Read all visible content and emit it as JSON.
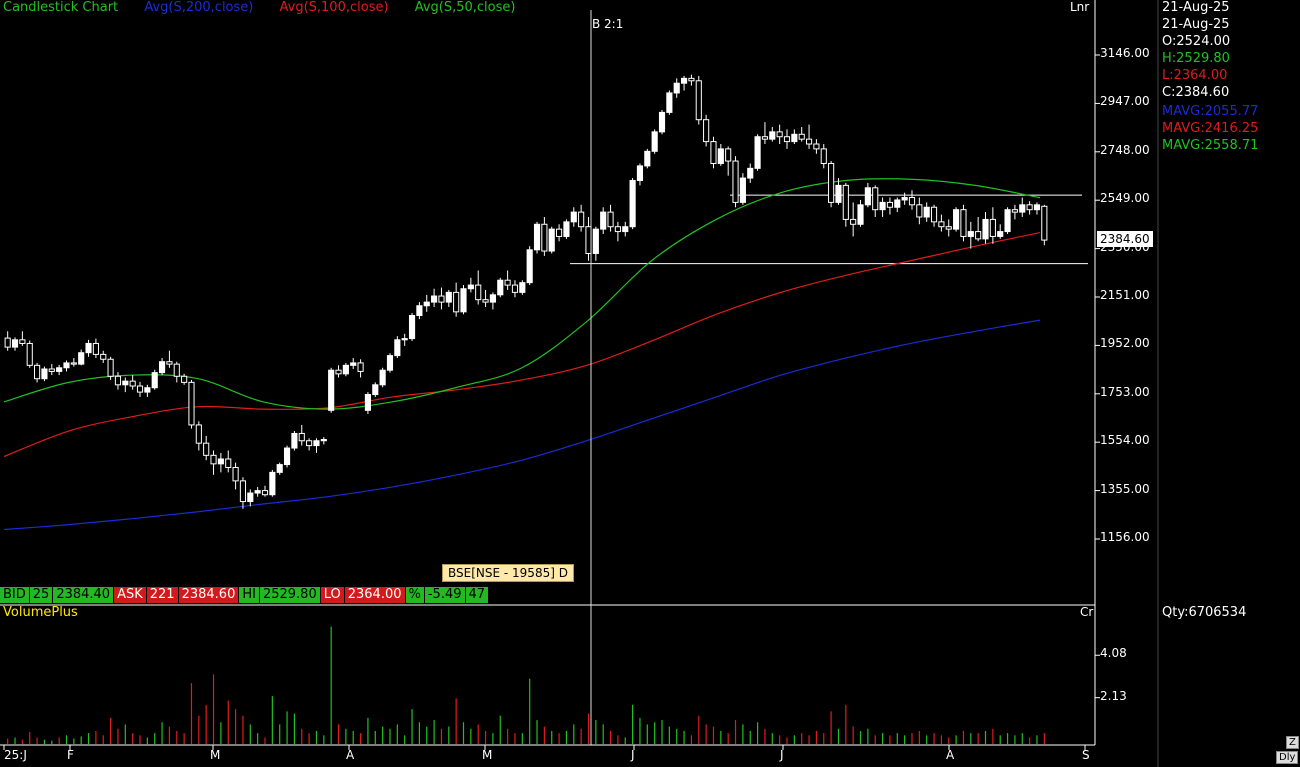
{
  "legend": {
    "title": "Candlestick Chart",
    "ma200": "Avg(S,200,close)",
    "ma100": "Avg(S,100,close)",
    "ma50": "Avg(S,50,close)"
  },
  "scale_mode": "Lnr",
  "volume_scale_unit": "Cr",
  "split_marker": "B 2:1",
  "side_panel": {
    "date1": "21-Aug-25",
    "date2": "21-Aug-25",
    "open": "O:2524.00",
    "high": "H:2529.80",
    "low": "L:2364.00",
    "close": "C:2384.60",
    "mavg200": "MAVG:2055.77",
    "mavg100": "MAVG:2416.25",
    "mavg50": "MAVG:2558.71",
    "qty": "Qty:6706534"
  },
  "quote_bar": {
    "bid_label": "BID",
    "bid_qty": "25",
    "bid_price": "2384.40",
    "ask_label": "ASK",
    "ask_qty": "221",
    "ask_price": "2384.60",
    "hi_label": "HI",
    "hi_value": "2529.80",
    "lo_label": "LO",
    "lo_value": "2364.00",
    "pct_label": "%",
    "pct_value": "-5.49",
    "extra": "47"
  },
  "tooltip": "BSE[NSE - 19585] D",
  "last_price_box": "2384.60",
  "volume_title": "VolumePlus",
  "colors": {
    "ma200": "#1a2cd8",
    "ma100": "#e01c1c",
    "ma50": "#22c022",
    "up_volume": "#22c022",
    "down_volume": "#e01c1c",
    "legend_title": "#22c022"
  },
  "chart_data": {
    "type": "candlestick",
    "title": "Candlestick Chart",
    "y_ticks": [
      "3146.00",
      "2947.00",
      "2748.00",
      "2549.00",
      "2350.00",
      "2151.00",
      "1952.00",
      "1753.00",
      "1554.00",
      "1355.00",
      "1156.00"
    ],
    "y_tick_values": [
      3146,
      2947,
      2748,
      2549,
      2350,
      2151,
      1952,
      1753,
      1554,
      1355,
      1156
    ],
    "ylim": [
      1000,
      3330
    ],
    "x_tick_labels": [
      "25:J",
      "F",
      "M",
      "A",
      "M",
      "J",
      "J",
      "A",
      "S"
    ],
    "volume_ticks": [
      "4.08",
      "2.13"
    ],
    "volume_tick_values": [
      4.08,
      2.13
    ],
    "volume_ylim": [
      0,
      5.7
    ],
    "horizontal_lines": [
      2570,
      2288
    ],
    "series": [
      {
        "name": "Avg(S,200,close)",
        "values": [
          1195,
          1215,
          1240,
          1268,
          1300,
          1330,
          1370,
          1420,
          1480,
          1560,
          1650,
          1740,
          1830,
          1900,
          1960,
          2010,
          2056
        ]
      },
      {
        "name": "Avg(S,100,close)",
        "values": [
          1495,
          1600,
          1660,
          1700,
          1690,
          1695,
          1740,
          1770,
          1810,
          1870,
          1970,
          2080,
          2170,
          2240,
          2300,
          2360,
          2416
        ]
      },
      {
        "name": "Avg(S,50,close)",
        "values": [
          1720,
          1800,
          1830,
          1815,
          1720,
          1690,
          1720,
          1780,
          1860,
          2050,
          2300,
          2470,
          2580,
          2630,
          2635,
          2610,
          2559
        ]
      }
    ],
    "candles": [
      [
        1982,
        2010,
        1930,
        1945
      ],
      [
        1945,
        1985,
        1930,
        1975
      ],
      [
        1975,
        2010,
        1950,
        1960
      ],
      [
        1960,
        1972,
        1860,
        1870
      ],
      [
        1870,
        1880,
        1800,
        1815
      ],
      [
        1815,
        1865,
        1805,
        1855
      ],
      [
        1855,
        1875,
        1830,
        1845
      ],
      [
        1845,
        1872,
        1830,
        1860
      ],
      [
        1860,
        1890,
        1845,
        1880
      ],
      [
        1880,
        1900,
        1865,
        1875
      ],
      [
        1875,
        1935,
        1870,
        1922
      ],
      [
        1922,
        1975,
        1905,
        1960
      ],
      [
        1960,
        1980,
        1900,
        1915
      ],
      [
        1915,
        1930,
        1880,
        1895
      ],
      [
        1895,
        1905,
        1810,
        1825
      ],
      [
        1825,
        1842,
        1770,
        1790
      ],
      [
        1790,
        1820,
        1760,
        1805
      ],
      [
        1805,
        1830,
        1770,
        1785
      ],
      [
        1785,
        1802,
        1740,
        1760
      ],
      [
        1760,
        1790,
        1740,
        1778
      ],
      [
        1778,
        1852,
        1770,
        1840
      ],
      [
        1840,
        1900,
        1830,
        1885
      ],
      [
        1885,
        1930,
        1860,
        1875
      ],
      [
        1875,
        1885,
        1800,
        1825
      ],
      [
        1825,
        1835,
        1790,
        1800
      ],
      [
        1800,
        1810,
        1610,
        1625
      ],
      [
        1625,
        1640,
        1520,
        1550
      ],
      [
        1550,
        1580,
        1480,
        1500
      ],
      [
        1500,
        1520,
        1420,
        1465
      ],
      [
        1465,
        1510,
        1430,
        1485
      ],
      [
        1485,
        1520,
        1430,
        1450
      ],
      [
        1450,
        1470,
        1360,
        1395
      ],
      [
        1395,
        1410,
        1280,
        1310
      ],
      [
        1310,
        1360,
        1290,
        1345
      ],
      [
        1345,
        1370,
        1330,
        1355
      ],
      [
        1355,
        1375,
        1330,
        1338
      ],
      [
        1338,
        1440,
        1330,
        1430
      ],
      [
        1430,
        1470,
        1420,
        1462
      ],
      [
        1462,
        1540,
        1450,
        1530
      ],
      [
        1530,
        1600,
        1520,
        1590
      ],
      [
        1590,
        1625,
        1540,
        1560
      ],
      [
        1560,
        1570,
        1520,
        1540
      ],
      [
        1540,
        1570,
        1510,
        1560
      ],
      [
        1560,
        1575,
        1545,
        1565
      ],
      [
        1685,
        1860,
        1675,
        1850
      ],
      [
        1850,
        1870,
        1820,
        1835
      ],
      [
        1835,
        1880,
        1825,
        1870
      ],
      [
        1870,
        1900,
        1855,
        1880
      ],
      [
        1880,
        1895,
        1820,
        1845
      ],
      [
        1685,
        1760,
        1670,
        1750
      ],
      [
        1750,
        1800,
        1740,
        1790
      ],
      [
        1790,
        1860,
        1780,
        1850
      ],
      [
        1850,
        1920,
        1840,
        1910
      ],
      [
        1910,
        1990,
        1900,
        1975
      ],
      [
        1975,
        2000,
        1950,
        1980
      ],
      [
        1980,
        2085,
        1970,
        2075
      ],
      [
        2075,
        2130,
        2060,
        2115
      ],
      [
        2115,
        2160,
        2090,
        2130
      ],
      [
        2130,
        2185,
        2110,
        2155
      ],
      [
        2155,
        2190,
        2100,
        2130
      ],
      [
        2130,
        2180,
        2110,
        2170
      ],
      [
        2170,
        2210,
        2070,
        2090
      ],
      [
        2090,
        2200,
        2080,
        2185
      ],
      [
        2185,
        2230,
        2170,
        2200
      ],
      [
        2200,
        2260,
        2120,
        2140
      ],
      [
        2140,
        2180,
        2110,
        2130
      ],
      [
        2130,
        2170,
        2100,
        2160
      ],
      [
        2160,
        2230,
        2150,
        2220
      ],
      [
        2220,
        2260,
        2180,
        2200
      ],
      [
        2200,
        2220,
        2150,
        2170
      ],
      [
        2170,
        2220,
        2160,
        2210
      ],
      [
        2210,
        2360,
        2200,
        2345
      ],
      [
        2345,
        2460,
        2330,
        2450
      ],
      [
        2450,
        2480,
        2320,
        2340
      ],
      [
        2340,
        2440,
        2330,
        2430
      ],
      [
        2430,
        2450,
        2380,
        2400
      ],
      [
        2400,
        2470,
        2390,
        2460
      ],
      [
        2460,
        2520,
        2440,
        2500
      ],
      [
        2500,
        2530,
        2420,
        2440
      ],
      [
        2440,
        2480,
        2300,
        2330
      ],
      [
        2330,
        2440,
        2300,
        2430
      ],
      [
        2430,
        2520,
        2410,
        2500
      ],
      [
        2500,
        2530,
        2420,
        2440
      ],
      [
        2440,
        2460,
        2380,
        2420
      ],
      [
        2420,
        2460,
        2400,
        2440
      ],
      [
        2440,
        2640,
        2430,
        2630
      ],
      [
        2630,
        2700,
        2610,
        2690
      ],
      [
        2690,
        2760,
        2680,
        2750
      ],
      [
        2750,
        2840,
        2740,
        2830
      ],
      [
        2830,
        2920,
        2820,
        2910
      ],
      [
        2910,
        3000,
        2900,
        2990
      ],
      [
        2990,
        3050,
        2970,
        3030
      ],
      [
        3030,
        3060,
        3000,
        3050
      ],
      [
        3050,
        3065,
        3020,
        3040
      ],
      [
        3040,
        3060,
        2860,
        2880
      ],
      [
        2880,
        2900,
        2770,
        2790
      ],
      [
        2790,
        2810,
        2680,
        2700
      ],
      [
        2700,
        2780,
        2690,
        2760
      ],
      [
        2760,
        2770,
        2650,
        2710
      ],
      [
        2710,
        2730,
        2520,
        2540
      ],
      [
        2540,
        2660,
        2530,
        2640
      ],
      [
        2640,
        2700,
        2620,
        2680
      ],
      [
        2680,
        2820,
        2670,
        2810
      ],
      [
        2810,
        2870,
        2780,
        2800
      ],
      [
        2800,
        2850,
        2790,
        2830
      ],
      [
        2830,
        2860,
        2780,
        2810
      ],
      [
        2810,
        2840,
        2760,
        2790
      ],
      [
        2790,
        2840,
        2780,
        2820
      ],
      [
        2820,
        2850,
        2790,
        2800
      ],
      [
        2800,
        2860,
        2760,
        2780
      ],
      [
        2780,
        2800,
        2740,
        2760
      ],
      [
        2760,
        2780,
        2680,
        2700
      ],
      [
        2700,
        2710,
        2520,
        2540
      ],
      [
        2540,
        2640,
        2530,
        2610
      ],
      [
        2610,
        2620,
        2440,
        2470
      ],
      [
        2470,
        2540,
        2400,
        2450
      ],
      [
        2450,
        2550,
        2440,
        2530
      ],
      [
        2530,
        2620,
        2520,
        2600
      ],
      [
        2600,
        2610,
        2480,
        2510
      ],
      [
        2510,
        2560,
        2480,
        2540
      ],
      [
        2540,
        2560,
        2490,
        2520
      ],
      [
        2520,
        2560,
        2500,
        2550
      ],
      [
        2550,
        2580,
        2530,
        2560
      ],
      [
        2560,
        2590,
        2510,
        2530
      ],
      [
        2530,
        2560,
        2450,
        2480
      ],
      [
        2480,
        2540,
        2460,
        2520
      ],
      [
        2520,
        2530,
        2440,
        2460
      ],
      [
        2460,
        2490,
        2420,
        2440
      ],
      [
        2440,
        2470,
        2400,
        2430
      ],
      [
        2430,
        2520,
        2420,
        2510
      ],
      [
        2510,
        2530,
        2380,
        2400
      ],
      [
        2400,
        2460,
        2350,
        2420
      ],
      [
        2420,
        2480,
        2380,
        2390
      ],
      [
        2390,
        2500,
        2370,
        2470
      ],
      [
        2470,
        2520,
        2370,
        2400
      ],
      [
        2400,
        2450,
        2390,
        2420
      ],
      [
        2420,
        2520,
        2410,
        2510
      ],
      [
        2510,
        2530,
        2470,
        2500
      ],
      [
        2500,
        2560,
        2480,
        2530
      ],
      [
        2530,
        2545,
        2490,
        2510
      ],
      [
        2510,
        2540,
        2490,
        2530
      ],
      [
        2524,
        2530,
        2364,
        2385
      ]
    ],
    "volumes": [
      [
        0.25,
        0
      ],
      [
        0.3,
        1
      ],
      [
        0.2,
        0
      ],
      [
        0.55,
        0
      ],
      [
        0.3,
        0
      ],
      [
        0.2,
        1
      ],
      [
        0.15,
        1
      ],
      [
        0.3,
        0
      ],
      [
        0.4,
        1
      ],
      [
        0.25,
        1
      ],
      [
        0.35,
        1
      ],
      [
        0.5,
        1
      ],
      [
        0.6,
        0
      ],
      [
        0.4,
        0
      ],
      [
        1.2,
        0
      ],
      [
        0.7,
        0
      ],
      [
        0.9,
        1
      ],
      [
        0.5,
        0
      ],
      [
        0.4,
        0
      ],
      [
        0.3,
        1
      ],
      [
        0.5,
        1
      ],
      [
        1.0,
        1
      ],
      [
        0.8,
        0
      ],
      [
        0.6,
        0
      ],
      [
        0.5,
        0
      ],
      [
        2.8,
        0
      ],
      [
        1.3,
        0
      ],
      [
        1.8,
        0
      ],
      [
        3.2,
        0
      ],
      [
        1.0,
        1
      ],
      [
        2.0,
        0
      ],
      [
        1.6,
        0
      ],
      [
        1.3,
        0
      ],
      [
        0.9,
        1
      ],
      [
        0.5,
        1
      ],
      [
        0.3,
        0
      ],
      [
        2.2,
        1
      ],
      [
        0.9,
        1
      ],
      [
        1.5,
        1
      ],
      [
        1.4,
        1
      ],
      [
        0.7,
        0
      ],
      [
        0.5,
        0
      ],
      [
        0.6,
        1
      ],
      [
        0.4,
        1
      ],
      [
        5.4,
        1
      ],
      [
        0.9,
        0
      ],
      [
        0.7,
        1
      ],
      [
        0.6,
        1
      ],
      [
        0.5,
        0
      ],
      [
        1.2,
        1
      ],
      [
        0.6,
        1
      ],
      [
        0.8,
        1
      ],
      [
        0.7,
        1
      ],
      [
        0.9,
        1
      ],
      [
        0.4,
        1
      ],
      [
        1.6,
        1
      ],
      [
        1.0,
        1
      ],
      [
        0.8,
        1
      ],
      [
        1.1,
        1
      ],
      [
        0.7,
        0
      ],
      [
        0.8,
        1
      ],
      [
        2.1,
        0
      ],
      [
        1.0,
        1
      ],
      [
        0.7,
        1
      ],
      [
        0.9,
        0
      ],
      [
        0.6,
        0
      ],
      [
        0.5,
        1
      ],
      [
        1.3,
        1
      ],
      [
        0.7,
        0
      ],
      [
        0.5,
        0
      ],
      [
        0.5,
        1
      ],
      [
        3.0,
        1
      ],
      [
        1.1,
        1
      ],
      [
        0.8,
        0
      ],
      [
        0.6,
        1
      ],
      [
        0.5,
        0
      ],
      [
        0.6,
        1
      ],
      [
        0.9,
        1
      ],
      [
        0.7,
        0
      ],
      [
        1.4,
        0
      ],
      [
        1.1,
        1
      ],
      [
        0.9,
        1
      ],
      [
        0.6,
        0
      ],
      [
        0.4,
        0
      ],
      [
        0.3,
        1
      ],
      [
        1.8,
        1
      ],
      [
        1.2,
        1
      ],
      [
        0.9,
        1
      ],
      [
        1.0,
        1
      ],
      [
        1.1,
        1
      ],
      [
        0.8,
        1
      ],
      [
        0.7,
        1
      ],
      [
        0.6,
        1
      ],
      [
        0.4,
        0
      ],
      [
        1.3,
        0
      ],
      [
        0.9,
        0
      ],
      [
        0.8,
        0
      ],
      [
        0.6,
        1
      ],
      [
        0.5,
        0
      ],
      [
        1.1,
        0
      ],
      [
        0.9,
        1
      ],
      [
        0.6,
        1
      ],
      [
        1.0,
        1
      ],
      [
        0.7,
        0
      ],
      [
        0.5,
        1
      ],
      [
        0.4,
        0
      ],
      [
        0.3,
        0
      ],
      [
        0.4,
        1
      ],
      [
        0.5,
        0
      ],
      [
        0.4,
        0
      ],
      [
        0.6,
        0
      ],
      [
        0.5,
        0
      ],
      [
        1.5,
        0
      ],
      [
        0.7,
        1
      ],
      [
        1.8,
        0
      ],
      [
        0.8,
        0
      ],
      [
        0.6,
        1
      ],
      [
        0.7,
        1
      ],
      [
        0.4,
        0
      ],
      [
        0.5,
        1
      ],
      [
        0.4,
        0
      ],
      [
        0.5,
        1
      ],
      [
        0.4,
        1
      ],
      [
        0.5,
        0
      ],
      [
        0.6,
        0
      ],
      [
        0.4,
        1
      ],
      [
        0.5,
        0
      ],
      [
        0.4,
        0
      ],
      [
        0.3,
        0
      ],
      [
        0.4,
        1
      ],
      [
        0.6,
        0
      ],
      [
        0.5,
        1
      ],
      [
        0.5,
        0
      ],
      [
        0.6,
        1
      ],
      [
        0.7,
        0
      ],
      [
        0.4,
        1
      ],
      [
        0.5,
        1
      ],
      [
        0.4,
        1
      ],
      [
        0.5,
        1
      ],
      [
        0.3,
        0
      ],
      [
        0.4,
        1
      ],
      [
        0.5,
        0
      ]
    ]
  }
}
